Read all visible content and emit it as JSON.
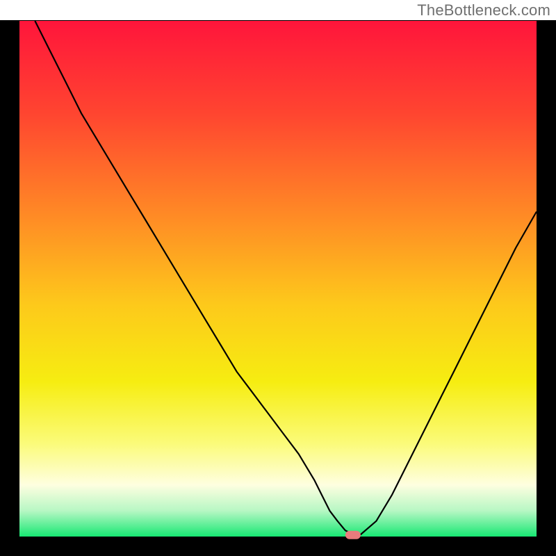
{
  "watermark": "TheBottleneck.com",
  "chart_data": {
    "type": "line",
    "title": "",
    "xlabel": "",
    "ylabel": "",
    "xlim": [
      0,
      100
    ],
    "ylim": [
      0,
      100
    ],
    "grid": false,
    "series": [
      {
        "name": "bottleneck-curve",
        "color": "#000000",
        "x": [
          3,
          6,
          9,
          12,
          15,
          18,
          21,
          24,
          27,
          30,
          33,
          36,
          39,
          42,
          45,
          48,
          51,
          54,
          57,
          58.5,
          60,
          61.5,
          63,
          64.5,
          66,
          69,
          72,
          75,
          78,
          81,
          84,
          87,
          90,
          93,
          96,
          100
        ],
        "y": [
          100,
          94,
          88,
          82,
          77,
          72,
          67,
          62,
          57,
          52,
          47,
          42,
          37,
          32,
          28,
          24,
          20,
          16,
          11,
          8,
          5,
          3,
          1.2,
          0.4,
          0.4,
          3,
          8,
          14,
          20,
          26,
          32,
          38,
          44,
          50,
          56,
          63
        ]
      }
    ],
    "marker": {
      "name": "minimum-marker",
      "x": 64.5,
      "y": 0.3,
      "color": "#E97B7D"
    },
    "background_gradient": {
      "stops": [
        {
          "offset": 0.0,
          "color": "#FF153B"
        },
        {
          "offset": 0.18,
          "color": "#FF4530"
        },
        {
          "offset": 0.38,
          "color": "#FF8B25"
        },
        {
          "offset": 0.55,
          "color": "#FDC91B"
        },
        {
          "offset": 0.7,
          "color": "#F6ED11"
        },
        {
          "offset": 0.82,
          "color": "#FBFB7A"
        },
        {
          "offset": 0.9,
          "color": "#FEFEE0"
        },
        {
          "offset": 0.95,
          "color": "#B7F7C4"
        },
        {
          "offset": 1.0,
          "color": "#17E873"
        }
      ]
    },
    "border_color": "#000000"
  }
}
